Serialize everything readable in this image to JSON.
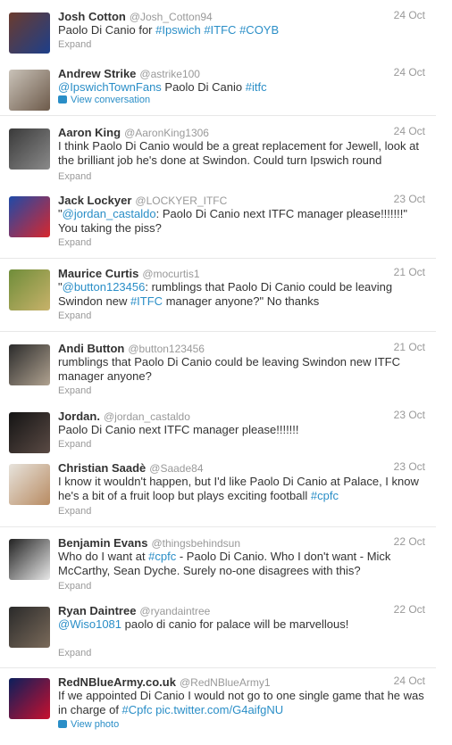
{
  "tweets": [
    {
      "name": "Josh Cotton",
      "handle": "@Josh_Cotton94",
      "date": "24 Oct",
      "parts": [
        {
          "t": "Paolo Di Canio for "
        },
        {
          "t": "#Ipswich",
          "link": true
        },
        {
          "t": " "
        },
        {
          "t": "#ITFC",
          "link": true
        },
        {
          "t": " "
        },
        {
          "t": "#COYB",
          "link": true
        }
      ],
      "expand": "Expand",
      "avatar": "ipswich fans photo",
      "colors": [
        "#6b3b2e",
        "#1d3f8a"
      ]
    },
    {
      "name": "Andrew Strike",
      "handle": "@astrike100",
      "date": "24 Oct",
      "parts": [
        {
          "t": "@IpswichTownFans",
          "link": true
        },
        {
          "t": " Paolo Di Canio "
        },
        {
          "t": "#itfc",
          "link": true
        }
      ],
      "extra": "View conversation",
      "extra_icon": "speech-bubble-icon",
      "avatar": "man photo",
      "colors": [
        "#c9c2b8",
        "#6d5a4a"
      ]
    },
    {
      "name": "Aaron King",
      "handle": "@AaronKing1306",
      "date": "24 Oct",
      "parts": [
        {
          "t": "I think Paolo Di Canio would be a great replacement for Jewell, look at the brilliant job he's done at Swindon. Could turn Ipswich round"
        }
      ],
      "expand": "Expand",
      "avatar": "silhouette photo",
      "colors": [
        "#3a3a3a",
        "#8a8a8a"
      ]
    },
    {
      "name": "Jack Lockyer",
      "handle": "@LOCKYER_ITFC",
      "date": "23 Oct",
      "parts": [
        {
          "t": "\""
        },
        {
          "t": "@jordan_castaldo",
          "link": true
        },
        {
          "t": ": Paolo Di Canio next ITFC manager please!!!!!!!\" You taking the piss?"
        }
      ],
      "expand": "Expand",
      "avatar": "ipswich crest",
      "colors": [
        "#1f4aa8",
        "#d8272d"
      ]
    },
    {
      "name": "Maurice Curtis",
      "handle": "@mocurtis1",
      "date": "21 Oct",
      "parts": [
        {
          "t": "\""
        },
        {
          "t": "@button123456",
          "link": true
        },
        {
          "t": ": rumblings that Paolo Di Canio could be leaving Swindon new "
        },
        {
          "t": "#ITFC",
          "link": true
        },
        {
          "t": " manager anyone?\" No thanks"
        }
      ],
      "expand": "Expand",
      "avatar": "outdoor photo",
      "colors": [
        "#6f8d3a",
        "#c8b26a"
      ]
    },
    {
      "name": "Andi Button",
      "handle": "@button123456",
      "date": "21 Oct",
      "parts": [
        {
          "t": "rumblings that Paolo Di Canio could be leaving Swindon new ITFC manager anyone?"
        }
      ],
      "expand": "Expand",
      "avatar": "trophy photo",
      "colors": [
        "#2b2b2b",
        "#b0a290"
      ]
    },
    {
      "name": "Jordan.",
      "handle": "@jordan_castaldo",
      "date": "23 Oct",
      "parts": [
        {
          "t": "Paolo Di Canio next ITFC manager please!!!!!!!"
        }
      ],
      "expand": "Expand",
      "avatar": "dark photo",
      "colors": [
        "#141414",
        "#5a4a44"
      ]
    },
    {
      "name": "Christian Saadè",
      "handle": "@Saade84",
      "date": "23 Oct",
      "parts": [
        {
          "t": "I know it wouldn't happen, but I'd like Paolo Di Canio at Palace, I know he's a bit of a fruit loop but plays exciting football "
        },
        {
          "t": "#cpfc",
          "link": true
        }
      ],
      "expand": "Expand",
      "avatar": "smiling man photo",
      "colors": [
        "#e7e3dc",
        "#b88b62"
      ]
    },
    {
      "name": "Benjamin Evans",
      "handle": "@thingsbehindsun",
      "date": "22 Oct",
      "parts": [
        {
          "t": "Who do I want at "
        },
        {
          "t": "#cpfc",
          "link": true
        },
        {
          "t": " - Paolo Di Canio. Who I don't want - Mick McCarthy, Sean Dyche. Surely no-one disagrees with this?"
        }
      ],
      "expand": "Expand",
      "avatar": "black and white photo",
      "colors": [
        "#222222",
        "#e8e8e8"
      ]
    },
    {
      "name": "Ryan Daintree",
      "handle": "@ryandaintree",
      "date": "22 Oct",
      "parts": [
        {
          "t": "@Wiso1081",
          "link": true
        },
        {
          "t": " paolo di canio for palace will be marvellous!"
        }
      ],
      "expand": "Expand",
      "avatar": "person photo",
      "colors": [
        "#2a2a2a",
        "#7a6a5a"
      ]
    },
    {
      "name": "RedNBlueArmy.co.uk",
      "handle": "@RedNBlueArmy1",
      "date": "24 Oct",
      "parts": [
        {
          "t": "If we appointed Di Canio I would not go to one single game that he was in charge of "
        },
        {
          "t": "#Cpfc",
          "link": true
        },
        {
          "t": " "
        },
        {
          "t": "pic.twitter.com/G4aifgNU",
          "link": true
        }
      ],
      "extra": "View photo",
      "extra_icon": "photo-icon",
      "avatar": "rednbluearmy logo",
      "colors": [
        "#0b1f5c",
        "#c8102e"
      ]
    }
  ]
}
